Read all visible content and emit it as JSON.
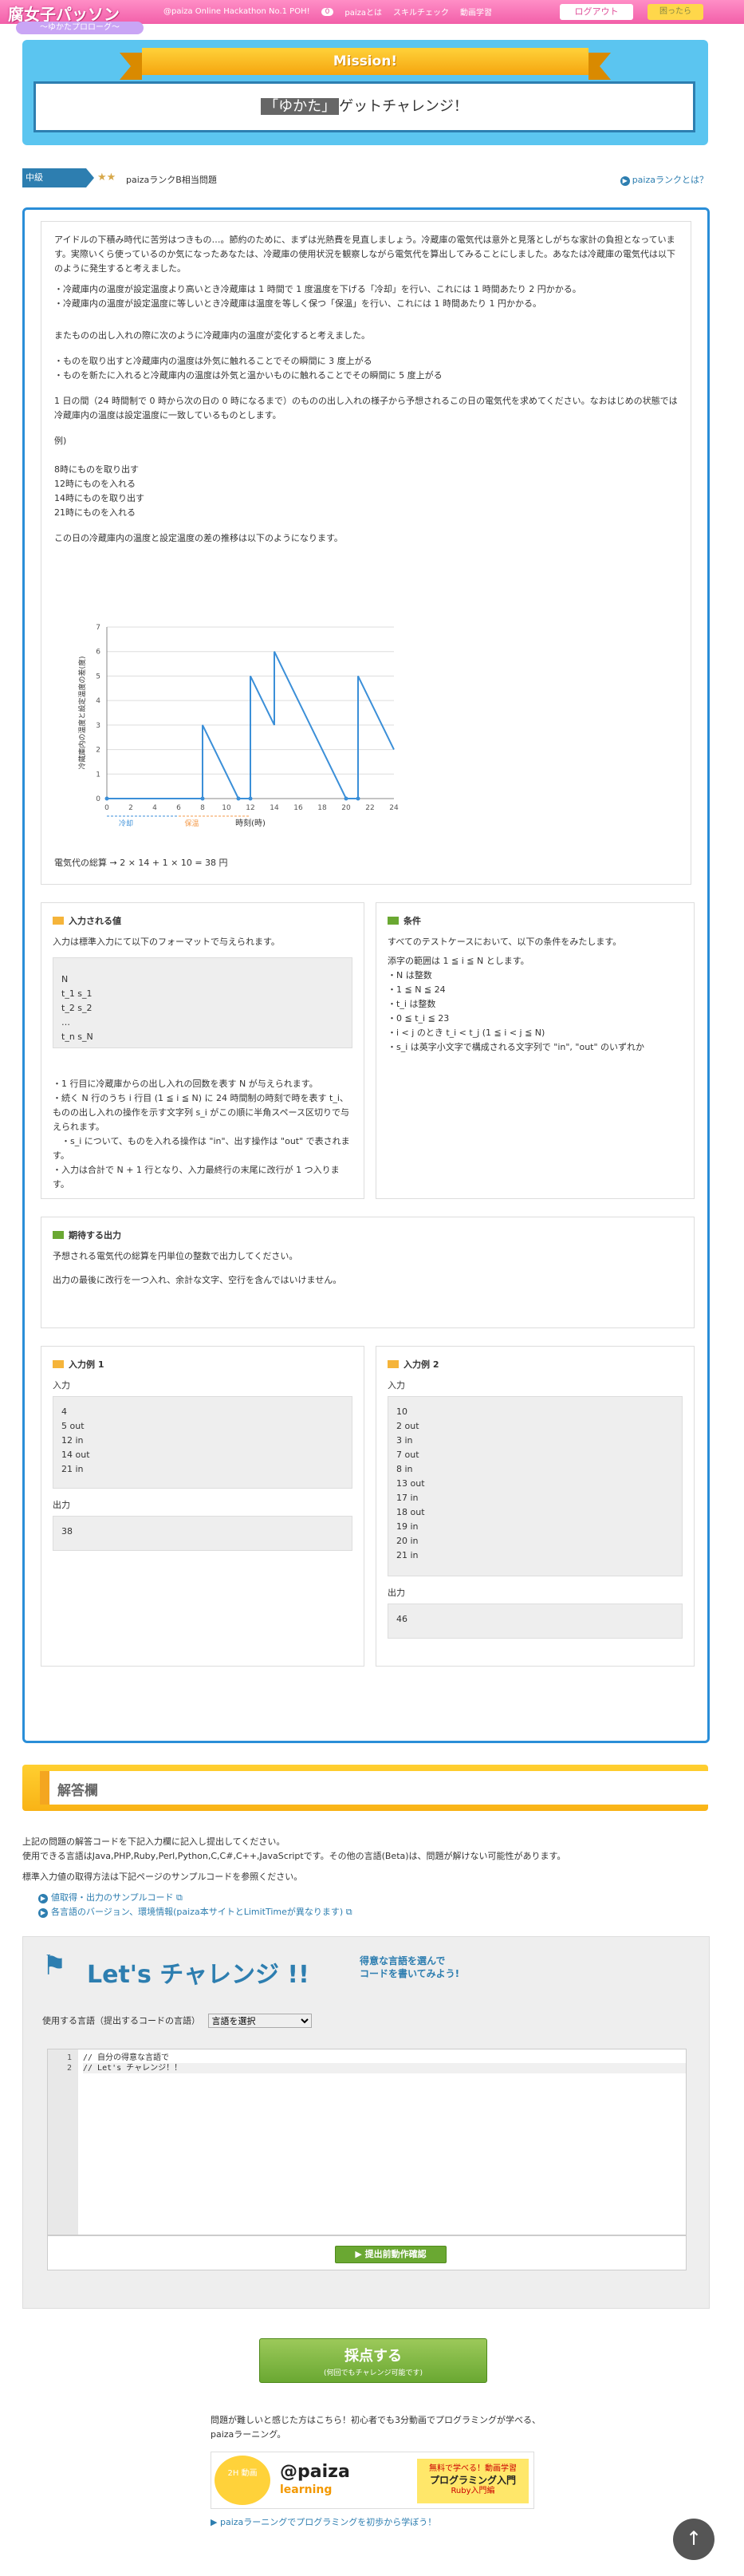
{
  "header": {
    "logo_title": "腐女子パッソン",
    "logo_sub": "～ゆかたプロローグ～",
    "nav": [
      "@paiza Online Hackathon No.1 POH!",
      "paizaとは",
      "スキルチェック",
      "動画学習"
    ],
    "nav_count": "0",
    "logout_label": "ログアウト",
    "help_label": "困ったら"
  },
  "mission": {
    "ribbon": "Mission!",
    "highlight": "「ゆかた」",
    "text": "ゲットチャレンジ！"
  },
  "level": {
    "tag": "中級",
    "stars": "★★",
    "text": "paizaランクB相当問題",
    "rank_link": "paizaランクとは？"
  },
  "problem": {
    "paragraphs": [
      "アイドルの下積み時代に苦労はつきもの…。節約のために、まずは光熱費を見直しましょう。冷蔵庫の電気代は意外と見落としがちな家計の負担となっています。実際いくら使っているのか気になったあなたは、冷蔵庫の使用状況を観察しながら電気代を算出してみることにしました。あなたは冷蔵庫の電気代は以下のように発生すると考えました。",
      "・冷蔵庫内の温度が設定温度より高いとき冷蔵庫は 1 時間で 1 度温度を下げる「冷却」を行い、これには 1 時間あたり 2 円かかる。",
      "・冷蔵庫内の温度が設定温度に等しいとき冷蔵庫は温度を等しく保つ「保温」を行い、これには 1 時間あたり 1 円かかる。",
      "またものの出し入れの際に次のように冷蔵庫内の温度が変化すると考えました。",
      "・ものを取り出すと冷蔵庫内の温度は外気に触れることでその瞬間に 3 度上がる",
      "・ものを新たに入れると冷蔵庫内の温度は外気と温かいものに触れることでその瞬間に 5 度上がる",
      "1 日の間（24 時間制で 0 時から次の日の 0 時になるまで）のものの出し入れの様子から予想されるこの日の電気代を求めてください。なおはじめの状態では冷蔵庫内の温度は設定温度に一致しているものとします。",
      "例)",
      "8時にものを取り出す",
      "12時にものを入れる",
      "14時にものを取り出す",
      "21時にものを入れる",
      "この日の冷蔵庫内の温度と設定温度の差の推移は以下のようになります。"
    ],
    "cost_text": "電気代の総算 → 2 × 14 + 1 × 10 = 38 円"
  },
  "chart_data": {
    "type": "line",
    "x": [
      0,
      8,
      8,
      11,
      12,
      12,
      14,
      14,
      16,
      20,
      21,
      21,
      24
    ],
    "y": [
      0,
      0,
      3,
      0,
      0,
      5,
      3,
      6,
      4,
      0,
      0,
      5,
      2
    ],
    "xlabel": "時刻(時)",
    "ylabel": "冷蔵庫内の温度と設定温度の差(度)",
    "xlim": [
      0,
      24
    ],
    "ylim": [
      0,
      7
    ],
    "xticks": [
      "0",
      "2",
      "4",
      "6",
      "8",
      "10",
      "12",
      "14",
      "16",
      "18",
      "20",
      "22",
      "24"
    ],
    "yticks": [
      "0",
      "1",
      "2",
      "3",
      "4",
      "5",
      "6",
      "7"
    ],
    "legend": [
      "冷却",
      "保温"
    ],
    "colors": {
      "line": "#3b8fd8",
      "cool": "#3b8fd8",
      "keep": "#f39a4a"
    }
  },
  "input_spec": {
    "title": "入力される値",
    "intro": "入力は標準入力にて以下のフォーマットで与えられます。",
    "format": "N\nt_1 s_1\nt_2 s_2\n…\nt_n s_N",
    "notes": [
      "・1 行目に冷蔵庫からの出し入れの回数を表す N が与えられます。",
      "・続く N 行のうち i 行目 (1 ≦ i ≦ N) に 24 時間制の時刻で時を表す t_i、ものの出し入れの操作を示す文字列 s_i がこの順に半角スペース区切りで与えられます。",
      "　・s_i について、ものを入れる操作は \"in\"、出す操作は \"out\" で表されます。",
      "・入力は合計で N + 1 行となり、入力最終行の末尾に改行が 1 つ入ります。"
    ]
  },
  "conditions": {
    "title": "条件",
    "intro": "すべてのテストケースにおいて、以下の条件をみたします。",
    "items": [
      "添字の範囲は 1 ≦ i ≦ N とします。",
      "・N は整数",
      "・1 ≦ N ≦ 24",
      "・t_i は整数",
      "・0 ≦ t_i ≦ 23",
      "・i < j のとき t_i < t_j (1 ≦ i < j ≦ N)",
      "・s_i は英字小文字で構成される文字列で \"in\", \"out\" のいずれか"
    ]
  },
  "expected_output": {
    "title": "期待する出力",
    "lines": [
      "予想される電気代の総算を円単位の整数で出力してください。",
      "出力の最後に改行を一つ入れ、余計な文字、空行を含んではいけません。"
    ]
  },
  "example1": {
    "title": "入力例 1",
    "input_label": "入力",
    "input": "4\n5 out\n12 in\n14 out\n21 in",
    "output_label": "出力",
    "output": "38"
  },
  "example2": {
    "title": "入力例 2",
    "input_label": "入力",
    "input": "10\n2 out\n3 in\n7 out\n8 in\n13 out\n17 in\n18 out\n19 in\n20 in\n21 in",
    "output_label": "出力",
    "output": "46"
  },
  "answer": {
    "title": "解答欄",
    "instr1": "上記の問題の解答コードを下記入力欄に記入し提出してください。",
    "instr2": "使用できる言語はJava,PHP,Ruby,Perl,Python,C,C#,C++,JavaScriptです。その他の言語(Beta)は、問題が解けない可能性があります。",
    "instr3": "標準入力値の取得方法は下記ページのサンプルコードを参照ください。",
    "links": [
      "値取得・出力のサンプルコード",
      "各言語のバージョン、環境情報(paiza本サイトとLimitTimeが異なります)"
    ]
  },
  "editor": {
    "lets_title": "Let's チャレンジ !!",
    "lets_sub1": "得意な言語を選んで",
    "lets_sub2": "コードを書いてみよう!",
    "lang_label": "使用する言語（提出するコードの言語）",
    "lang_select": "言語を選択",
    "line_numbers": [
      "1",
      "2"
    ],
    "code_lines": [
      "// 自分の得意な言語で",
      "// Let's チャレンジ！！"
    ],
    "run_label": "提出前動作確認"
  },
  "submit": {
    "label": "採点する",
    "sub": "(何回でもチャレンジ可能です)"
  },
  "promo": {
    "text": "問題が難しいと感じた方はこちら！初心者でも3分動画でプログラミングが学べる、paizaラーニング。",
    "banner_left": "2H 動画",
    "banner_brand": "@paiza",
    "banner_brand2": "learning",
    "banner_right1": "無料で学べる！動画学習",
    "banner_right2": "プログラミング入門",
    "banner_right3": "Ruby入門編",
    "link": "paizaラーニングでプログラミングを初歩から学ぼう！"
  },
  "totop": "↑"
}
